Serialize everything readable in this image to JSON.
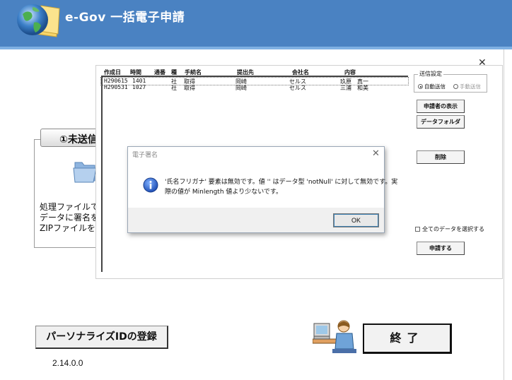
{
  "app": {
    "title": "e-Gov 一括電子申請"
  },
  "left_panel": {
    "tab_label": "①未送信",
    "text_lines": [
      "処理ファイルで作",
      "データに署名を",
      "ZIPファイルを作"
    ]
  },
  "list": {
    "columns": [
      "作成日",
      "時間",
      "通番",
      "種",
      "手続名",
      "提出先",
      "会社名",
      "内容"
    ],
    "rows": [
      [
        "H290615",
        "1401",
        "",
        "社",
        "取得",
        "岡崎",
        "セルス",
        "玖原　真一"
      ],
      [
        "H290531",
        "1027",
        "",
        "社",
        "取得",
        "岡崎",
        "セルス",
        "三浦　和美"
      ]
    ]
  },
  "send_settings": {
    "title": "送信設定",
    "auto": "自動送信",
    "manual": "手動送信"
  },
  "buttons": {
    "applicant": "申請者の表示",
    "data_folder": "データフォルダ",
    "delete": "削除",
    "select_all": "全てのデータを選択する",
    "apply": "申請する",
    "personalize": "パーソナライズIDの登録",
    "exit": "終了"
  },
  "dialog": {
    "title": "電子署名",
    "message_line1": "'氏名フリガナ' 要素は無効です。値 '' はデータ型 'notNull' に対して無効です。実",
    "message_line2": "際の値が Minlength 値より少ないです。",
    "ok": "OK"
  },
  "version": "2.14.0.0",
  "colors": {
    "header": "#4a82c2",
    "header_line": "#7fb0e2"
  }
}
